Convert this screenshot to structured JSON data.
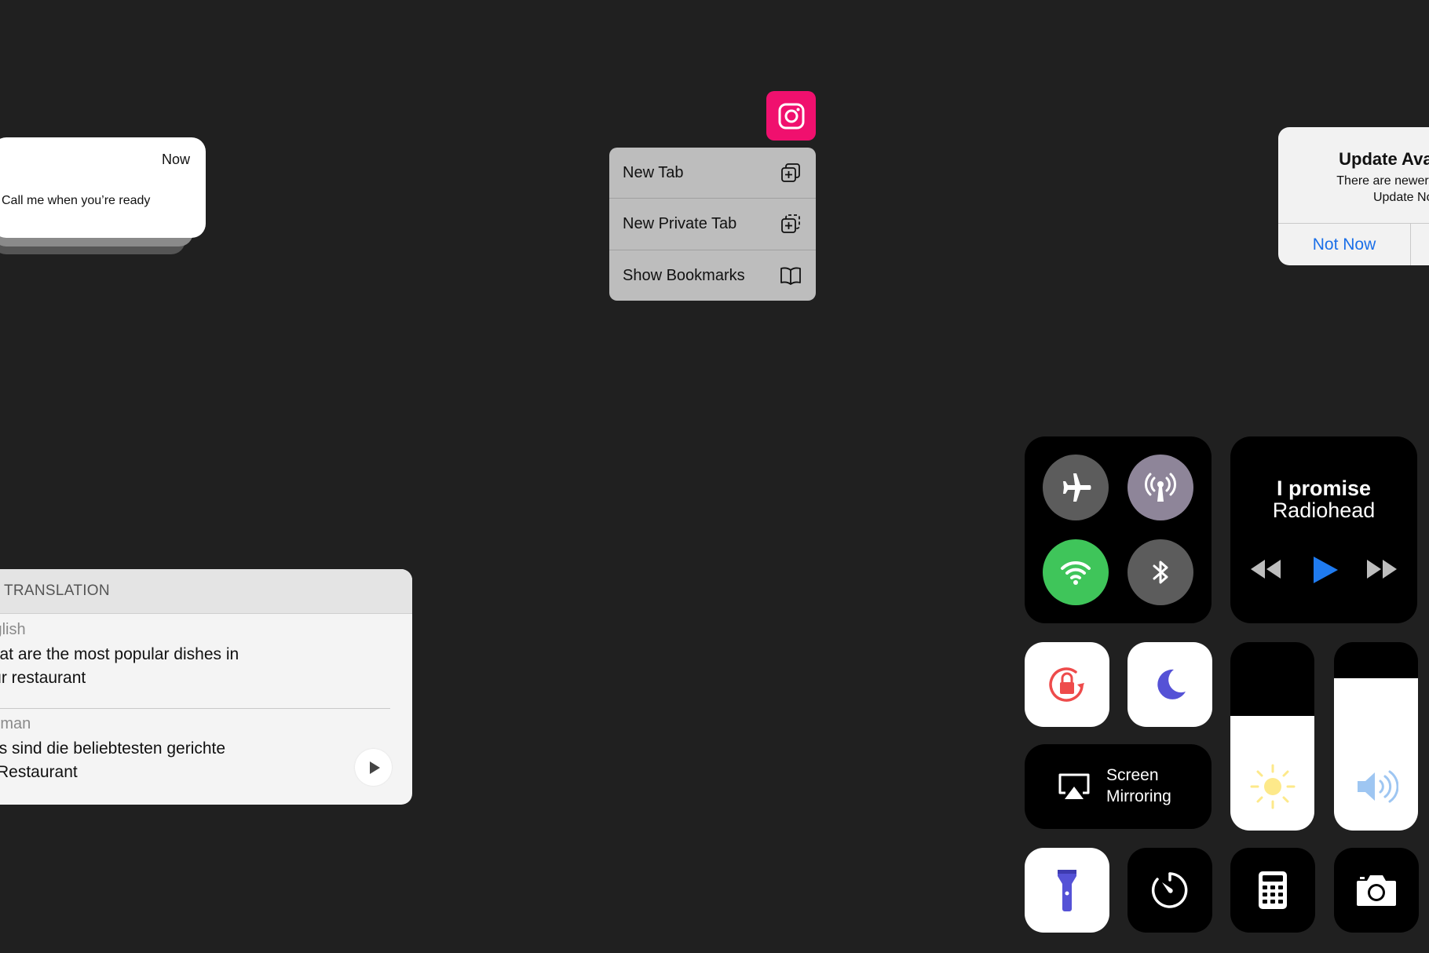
{
  "notification": {
    "time": "Now",
    "message": "Call me when you’re ready"
  },
  "context_menu": {
    "app_icon": "instagram-icon",
    "items": [
      {
        "label": "New Tab",
        "icon": "new-tab-icon"
      },
      {
        "label": "New Private Tab",
        "icon": "new-private-tab-icon"
      },
      {
        "label": "Show Bookmarks",
        "icon": "bookmarks-book-icon"
      }
    ]
  },
  "alert": {
    "title": "Update Available",
    "body_line1": "There are newer versions",
    "body_line2": "Update Now",
    "button_left": "Not Now",
    "accent": "#1a6fe8"
  },
  "translation": {
    "header": "TRANSLATION",
    "source_lang": "English",
    "source_text_line1": "What are the most popular dishes in",
    "source_text_line2": "your restaurant",
    "target_lang": "German",
    "target_text_line1": "Was sind die beliebtesten gerichte",
    "target_text_line2": "im Restaurant"
  },
  "control_center": {
    "toggles": {
      "airplane": {
        "icon": "airplane-icon",
        "color": "#5c5c5c"
      },
      "cellular": {
        "icon": "antenna-icon",
        "color": "#8e8599"
      },
      "wifi": {
        "icon": "wifi-icon",
        "color": "#3fc55a"
      },
      "bluetooth": {
        "icon": "bluetooth-icon",
        "color": "#5c5c5c"
      }
    },
    "music": {
      "title": "I promise",
      "artist": "Radiohead",
      "play_color": "#1f7bf0"
    },
    "screen_mirroring": {
      "line1": "Screen",
      "line2": "Mirroring"
    },
    "brightness_level": 0.61,
    "volume_level": 0.81,
    "tiles": [
      "rotation-lock-icon",
      "moon-icon",
      "flashlight-icon",
      "timer-icon",
      "calculator-icon",
      "camera-icon"
    ]
  }
}
